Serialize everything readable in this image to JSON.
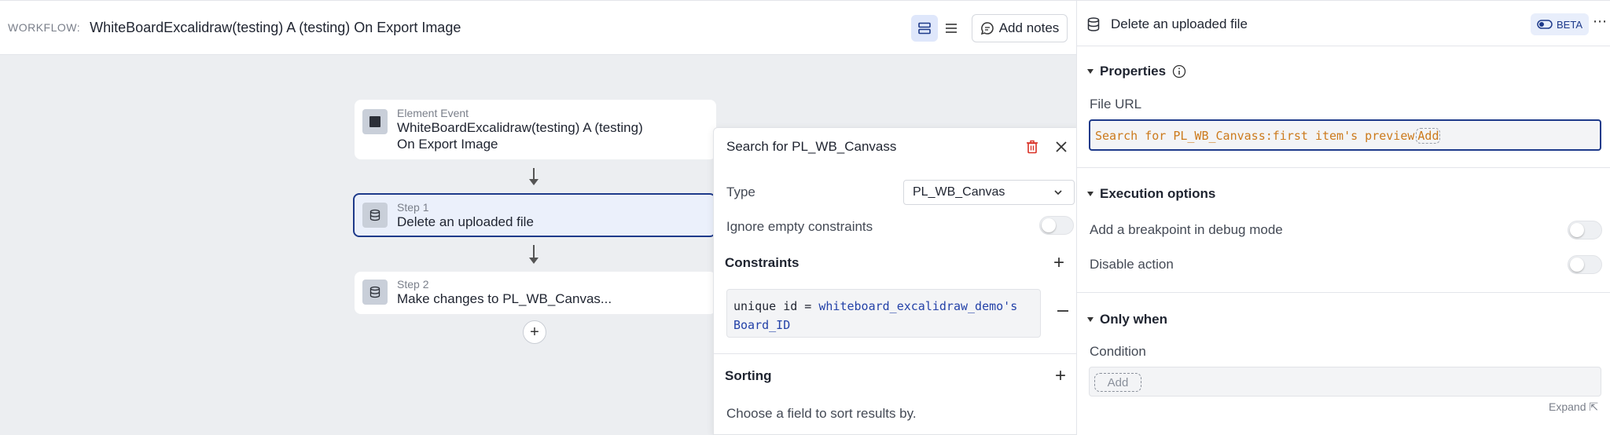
{
  "header": {
    "workflow_label": "WORKFLOW:",
    "workflow_title": "WhiteBoardExcalidraw(testing) A (testing)  On Export Image",
    "add_notes_label": "Add notes"
  },
  "canvas": {
    "nodes": [
      {
        "subtitle": "Element Event",
        "title_line1": "WhiteBoardExcalidraw(testing) A (testing)",
        "title_line2": "On Export Image"
      },
      {
        "subtitle": "Step 1",
        "title": "Delete an uploaded file"
      },
      {
        "subtitle": "Step 2",
        "title": "Make changes to PL_WB_Canvas..."
      }
    ],
    "add_step_symbol": "+"
  },
  "search_popup": {
    "title": "Search for PL_WB_Canvass",
    "type_label": "Type",
    "type_value": "PL_WB_Canvas",
    "ignore_empty_label": "Ignore empty constraints",
    "constraints_header": "Constraints",
    "constraint": {
      "field": "unique id = ",
      "value_line1": "whiteboard_excalidraw_demo's",
      "value_line2": "Board_ID"
    },
    "sorting_header": "Sorting",
    "sorting_hint": "Choose a field to sort results by."
  },
  "right_panel": {
    "title": "Delete an uploaded file",
    "beta_label": "BETA",
    "more_label": "⋯",
    "properties_header": "Properties",
    "file_url_label": "File URL",
    "file_url_value": "Search for PL_WB_Canvass:first item's preview",
    "file_url_add": "Add",
    "execution_header": "Execution options",
    "breakpoint_label": "Add a breakpoint in debug mode",
    "disable_label": "Disable action",
    "only_when_header": "Only when",
    "condition_label": "Condition",
    "condition_add": "Add",
    "expand_label": "Expand ⇱"
  },
  "colors": {
    "accent": "#1e3a8a",
    "dynamic_expression": "#cc7a1c",
    "delete_red": "#d93025",
    "canvas_bg": "#eceef1"
  }
}
